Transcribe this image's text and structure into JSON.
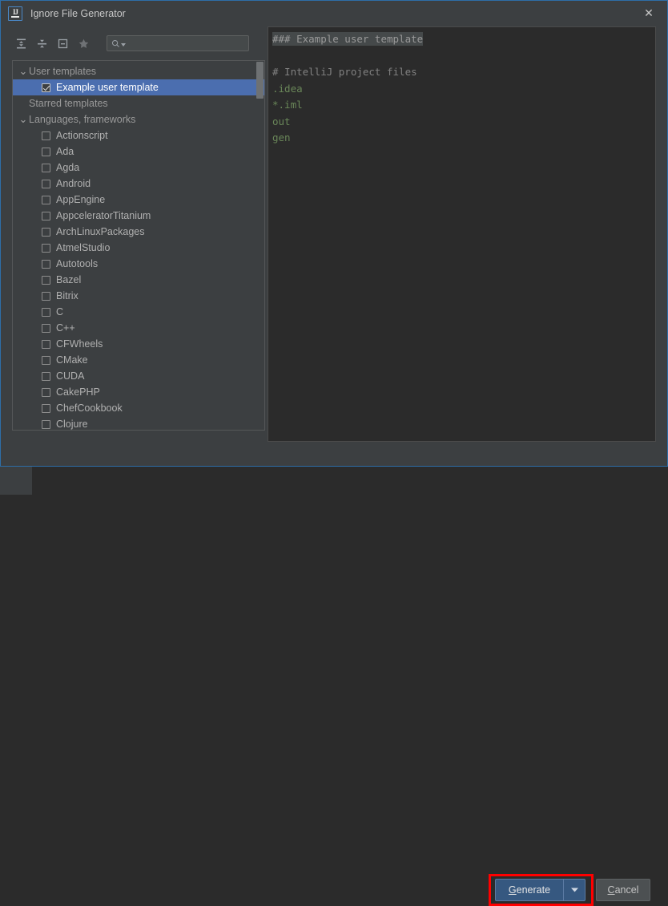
{
  "window": {
    "title": "Ignore File Generator",
    "app_icon": "intellij-idea-icon",
    "icon_text": "IJ",
    "close_label": "✕",
    "border_color": "#2d6ea8"
  },
  "toolbar": {
    "icons": [
      {
        "name": "expand-all-icon",
        "tooltip": "Expand All"
      },
      {
        "name": "collapse-all-icon",
        "tooltip": "Collapse All"
      },
      {
        "name": "unselect-all-icon",
        "tooltip": "Unselect All"
      },
      {
        "name": "star-icon",
        "tooltip": "Starred"
      }
    ]
  },
  "search": {
    "value": "",
    "placeholder": "",
    "icon": "search-icon",
    "dropdown_icon": "chevron-down-icon"
  },
  "tree": {
    "items": [
      {
        "label": "User templates",
        "type": "group",
        "expanded": true,
        "indent": 0,
        "checkbox": false,
        "checked": false,
        "selected": false
      },
      {
        "label": "Example user template",
        "type": "leaf",
        "expanded": false,
        "indent": 1,
        "checkbox": true,
        "checked": true,
        "selected": true
      },
      {
        "label": "Starred templates",
        "type": "group",
        "expanded": false,
        "indent": 0,
        "checkbox": false,
        "checked": false,
        "selected": false
      },
      {
        "label": "Languages, frameworks",
        "type": "group",
        "expanded": true,
        "indent": 0,
        "checkbox": false,
        "checked": false,
        "selected": false
      },
      {
        "label": "Actionscript",
        "type": "leaf",
        "expanded": false,
        "indent": 1,
        "checkbox": true,
        "checked": false,
        "selected": false
      },
      {
        "label": "Ada",
        "type": "leaf",
        "expanded": false,
        "indent": 1,
        "checkbox": true,
        "checked": false,
        "selected": false
      },
      {
        "label": "Agda",
        "type": "leaf",
        "expanded": false,
        "indent": 1,
        "checkbox": true,
        "checked": false,
        "selected": false
      },
      {
        "label": "Android",
        "type": "leaf",
        "expanded": false,
        "indent": 1,
        "checkbox": true,
        "checked": false,
        "selected": false
      },
      {
        "label": "AppEngine",
        "type": "leaf",
        "expanded": false,
        "indent": 1,
        "checkbox": true,
        "checked": false,
        "selected": false
      },
      {
        "label": "AppceleratorTitanium",
        "type": "leaf",
        "expanded": false,
        "indent": 1,
        "checkbox": true,
        "checked": false,
        "selected": false
      },
      {
        "label": "ArchLinuxPackages",
        "type": "leaf",
        "expanded": false,
        "indent": 1,
        "checkbox": true,
        "checked": false,
        "selected": false
      },
      {
        "label": "AtmelStudio",
        "type": "leaf",
        "expanded": false,
        "indent": 1,
        "checkbox": true,
        "checked": false,
        "selected": false
      },
      {
        "label": "Autotools",
        "type": "leaf",
        "expanded": false,
        "indent": 1,
        "checkbox": true,
        "checked": false,
        "selected": false
      },
      {
        "label": "Bazel",
        "type": "leaf",
        "expanded": false,
        "indent": 1,
        "checkbox": true,
        "checked": false,
        "selected": false
      },
      {
        "label": "Bitrix",
        "type": "leaf",
        "expanded": false,
        "indent": 1,
        "checkbox": true,
        "checked": false,
        "selected": false
      },
      {
        "label": "C",
        "type": "leaf",
        "expanded": false,
        "indent": 1,
        "checkbox": true,
        "checked": false,
        "selected": false
      },
      {
        "label": "C++",
        "type": "leaf",
        "expanded": false,
        "indent": 1,
        "checkbox": true,
        "checked": false,
        "selected": false
      },
      {
        "label": "CFWheels",
        "type": "leaf",
        "expanded": false,
        "indent": 1,
        "checkbox": true,
        "checked": false,
        "selected": false
      },
      {
        "label": "CMake",
        "type": "leaf",
        "expanded": false,
        "indent": 1,
        "checkbox": true,
        "checked": false,
        "selected": false
      },
      {
        "label": "CUDA",
        "type": "leaf",
        "expanded": false,
        "indent": 1,
        "checkbox": true,
        "checked": false,
        "selected": false
      },
      {
        "label": "CakePHP",
        "type": "leaf",
        "expanded": false,
        "indent": 1,
        "checkbox": true,
        "checked": false,
        "selected": false
      },
      {
        "label": "ChefCookbook",
        "type": "leaf",
        "expanded": false,
        "indent": 1,
        "checkbox": true,
        "checked": false,
        "selected": false
      },
      {
        "label": "Clojure",
        "type": "leaf",
        "expanded": false,
        "indent": 1,
        "checkbox": true,
        "checked": false,
        "selected": false
      }
    ]
  },
  "preview": {
    "lines": [
      {
        "text": "### Example user template",
        "style": "highlight"
      },
      {
        "text": "",
        "style": "plain"
      },
      {
        "text": "# IntelliJ project files",
        "style": "comment"
      },
      {
        "text": ".idea",
        "style": "entry"
      },
      {
        "text": "*.iml",
        "style": "entry"
      },
      {
        "text": "out",
        "style": "entry"
      },
      {
        "text": "gen",
        "style": "entry"
      }
    ]
  },
  "buttons": {
    "generate": {
      "label": "Generate",
      "mnemonic": "G",
      "arrow_icon": "chevron-down-icon",
      "highlighted": true,
      "highlight_color": "#ff0000"
    },
    "cancel": {
      "label": "Cancel",
      "mnemonic": "C"
    }
  }
}
